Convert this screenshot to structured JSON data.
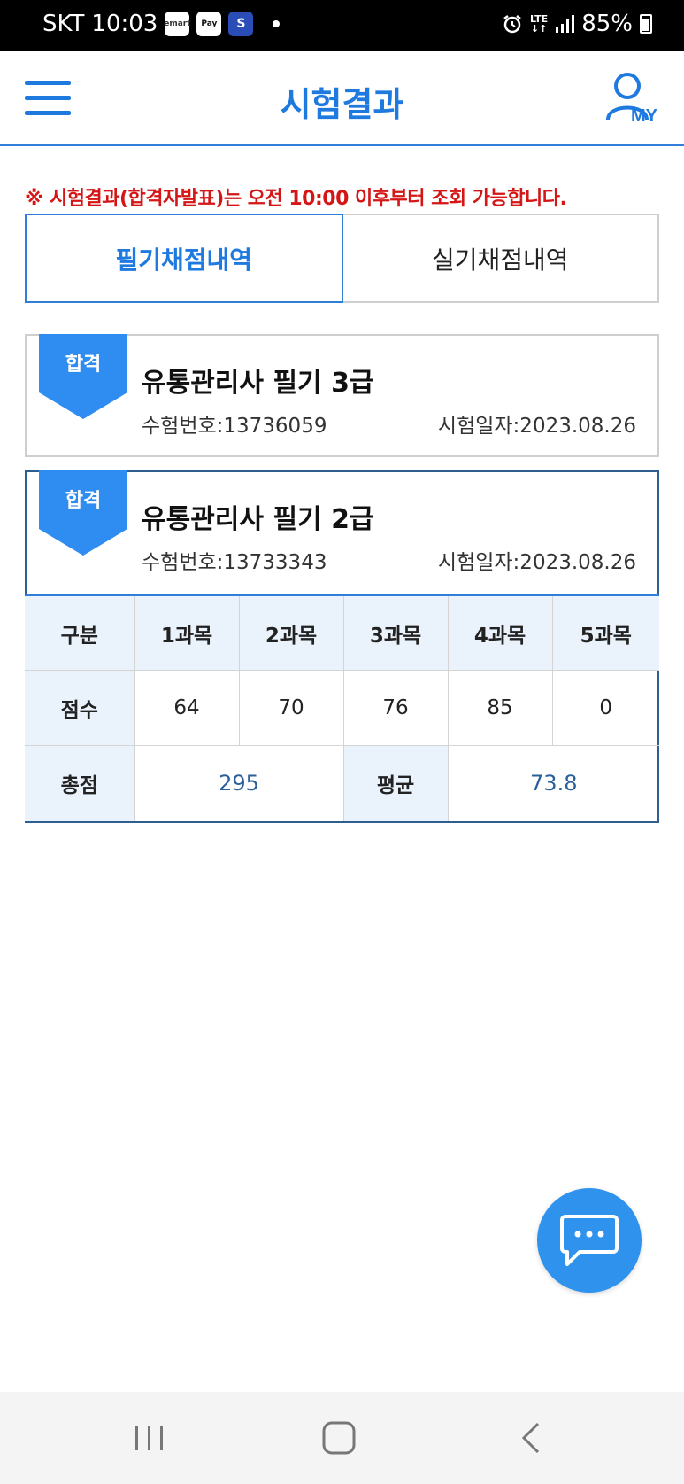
{
  "status_bar": {
    "carrier": "SKT",
    "time": "10:03",
    "app_icons": [
      {
        "name": "emart-icon",
        "label": "emart"
      },
      {
        "name": "pay-icon",
        "label": "Pay"
      },
      {
        "name": "bank-icon",
        "label": "S"
      }
    ],
    "network": "LTE",
    "battery": "85%"
  },
  "header": {
    "title": "시험결과",
    "my_label": "MY"
  },
  "notice": "※ 시험결과(합격자발표)는 오전 10:00 이후부터 조회 가능합니다.",
  "tabs": [
    {
      "label": "필기채점내역",
      "active": true
    },
    {
      "label": "실기채점내역",
      "active": false
    }
  ],
  "results": [
    {
      "badge": "합격",
      "name": "유통관리사 필기 3급",
      "exam_no": "수험번호:13736059",
      "exam_date": "시험일자:2023.08.26"
    },
    {
      "badge": "합격",
      "name": "유통관리사 필기 2급",
      "exam_no": "수험번호:13733343",
      "exam_date": "시험일자:2023.08.26"
    }
  ],
  "score_table": {
    "header": [
      "구분",
      "1과목",
      "2과목",
      "3과목",
      "4과목",
      "5과목"
    ],
    "score_label": "점수",
    "scores": [
      "64",
      "70",
      "76",
      "85",
      "0"
    ],
    "total_label": "총점",
    "total": "295",
    "average_label": "평균",
    "average": "73.8"
  },
  "colors": {
    "accent": "#1f7ae0",
    "notice": "#d41616",
    "badge": "#2f8cf0",
    "fab": "#2f93ee"
  }
}
